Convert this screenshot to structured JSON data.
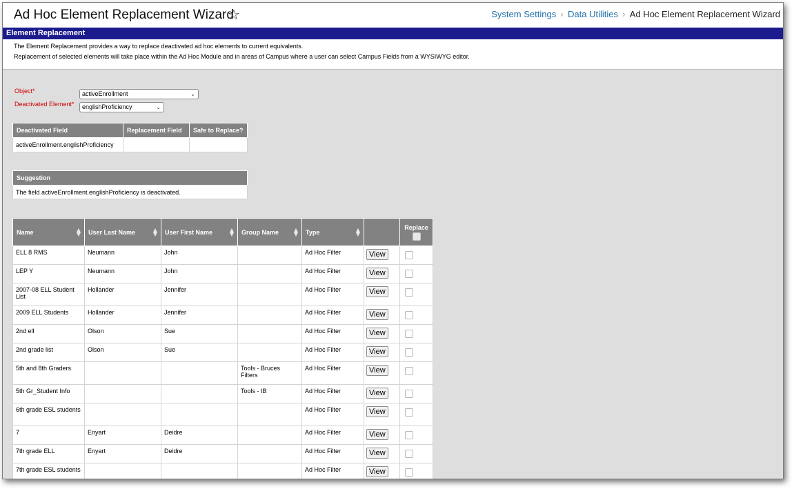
{
  "header": {
    "title": "Ad Hoc Element Replacement Wizard",
    "star": "☆",
    "breadcrumb": [
      "System Settings",
      "Data Utilities",
      "Ad Hoc Element Replacement Wizard"
    ],
    "sep": "›"
  },
  "section": {
    "title": "Element Replacement",
    "desc1": "The Element Replacement provides a way to replace deactivated ad hoc elements to current equivalents.",
    "desc2": "Replacement of selected elements will take place within the Ad Hoc Module and in areas of Campus where a user can select Campus Fields from a WYSIWYG editor."
  },
  "form": {
    "object_label": "Object*",
    "object_value": "activeEnrollment",
    "element_label": "Deactivated Element*",
    "element_value": "englishProficiency"
  },
  "fieldTable": {
    "headers": [
      "Deactivated Field",
      "Replacement Field",
      "Safe to Replace?"
    ],
    "row": [
      "activeEnrollment.englishProficiency",
      "",
      ""
    ]
  },
  "suggestion": {
    "header": "Suggestion",
    "text": "The field activeEnrollment.englishProficiency is deactivated."
  },
  "results": {
    "headers": [
      "Name",
      "User Last Name",
      "User First Name",
      "Group Name",
      "Type",
      "",
      "Replace"
    ],
    "view_label": "View",
    "rows": [
      {
        "name": "ELL 8 RMS",
        "last": "Neumann",
        "first": "John",
        "group": "",
        "type": "Ad Hoc Filter"
      },
      {
        "name": "LEP Y",
        "last": "Neumann",
        "first": "John",
        "group": "",
        "type": "Ad Hoc Filter"
      },
      {
        "name": "2007-08 ELL Student List",
        "last": "Hollander",
        "first": "Jennifer",
        "group": "",
        "type": "Ad Hoc Filter"
      },
      {
        "name": "2009 ELL Students",
        "last": "Hollander",
        "first": "Jennifer",
        "group": "",
        "type": "Ad Hoc Filter"
      },
      {
        "name": "2nd ell",
        "last": "Olson",
        "first": "Sue",
        "group": "",
        "type": "Ad Hoc Filter"
      },
      {
        "name": "2nd grade list",
        "last": "Olson",
        "first": "Sue",
        "group": "",
        "type": "Ad Hoc Filter"
      },
      {
        "name": "5th and 8th Graders",
        "last": "",
        "first": "",
        "group": "Tools - Bruces Filters",
        "type": "Ad Hoc Filter"
      },
      {
        "name": "5th Gr_Student Info",
        "last": "",
        "first": "",
        "group": "Tools - IB",
        "type": "Ad Hoc Filter"
      },
      {
        "name": "6th grade ESL students",
        "last": "",
        "first": "",
        "group": "",
        "type": "Ad Hoc Filter"
      },
      {
        "name": "7",
        "last": "Enyart",
        "first": "Deidre",
        "group": "",
        "type": "Ad Hoc Filter"
      },
      {
        "name": "7th grade ELL",
        "last": "Enyart",
        "first": "Deidre",
        "group": "",
        "type": "Ad Hoc Filter"
      },
      {
        "name": "7th grade ESL students",
        "last": "",
        "first": "",
        "group": "",
        "type": "Ad Hoc Filter"
      }
    ]
  }
}
